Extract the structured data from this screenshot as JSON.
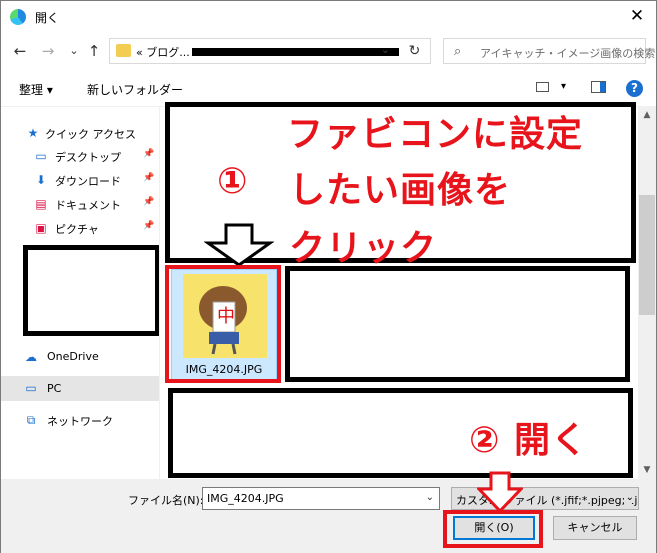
{
  "window": {
    "title": "開く"
  },
  "nav": {
    "back": "←",
    "forward": "→",
    "recent": "⌄",
    "up": "↑",
    "address": "« ブログ...",
    "address_dropdown": "⌄",
    "refresh": "↻",
    "search_placeholder": "アイキャッチ・イメージ画像の検索"
  },
  "toolbar": {
    "organize": "整理 ▾",
    "new_folder": "新しいフォルダー",
    "view_dropdown": "▾",
    "help": "?"
  },
  "sidebar": {
    "items": [
      {
        "label": "クイック アクセス",
        "icon": "star-icon"
      },
      {
        "label": "デスクトップ",
        "icon": "desktop-icon",
        "pinned": true
      },
      {
        "label": "ダウンロード",
        "icon": "download-icon",
        "pinned": true
      },
      {
        "label": "ドキュメント",
        "icon": "document-icon",
        "pinned": true
      },
      {
        "label": "ピクチャ",
        "icon": "pictures-icon",
        "pinned": true
      },
      {
        "label": "OneDrive",
        "icon": "onedrive-icon"
      },
      {
        "label": "PC",
        "icon": "pc-icon"
      },
      {
        "label": "ネットワーク",
        "icon": "network-icon"
      }
    ],
    "pin_glyph": "📌"
  },
  "content": {
    "file": {
      "name": "IMG_4204.JPG"
    },
    "annotations": {
      "step1_number": "①",
      "step1_line1": "ファビコンに設定",
      "step1_line2": "したい画像を",
      "step1_line3": "クリック",
      "step2": "② 開く"
    }
  },
  "bottom": {
    "filename_label": "ファイル名(N):",
    "filename_value": "IMG_4204.JPG",
    "filter_value": "カスタム ファイル (*.jfif;*.pjpeg;*.jp",
    "open_button": "開く(O)",
    "cancel_button": "キャンセル",
    "dropdown": "⌄"
  },
  "colors": {
    "annotation_red": "#e8141c",
    "selection_blue": "#cce8ff",
    "accent_blue": "#0078d7"
  }
}
